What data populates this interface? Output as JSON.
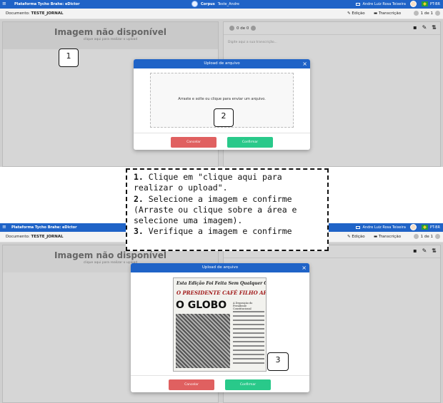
{
  "app": {
    "title": "Plataforma Tycho Brahe: eDictor",
    "corpus_label": "Corpus",
    "corpus_name": "Teste_Andre",
    "user_name": "Andre Luiz Rosa Teixeira",
    "locale": "PT-BR"
  },
  "docbar": {
    "doc_label": "Documento:",
    "doc_name": "TESTE_JORNAL",
    "edit_label": "Edição",
    "transcription_label": "Transcrição",
    "page_indicator": "1 de 1"
  },
  "left_pane": {
    "unavailable": "Imagem não disponível",
    "hint": "clique aqui para realizar o upload"
  },
  "right_pane": {
    "page_count": "0 de 0",
    "placeholder": "Digite aqui a sua transcrição..."
  },
  "modal": {
    "title": "Upload de arquivo",
    "dropzone_text": "Arraste e solte ou clique para enviar um arquivo.",
    "cancel_label": "Cancelar",
    "confirm_label": "Confirmar"
  },
  "newspaper": {
    "line1": "Esta Edição Foi Feita Sem Qualquer Censura",
    "line2": "O PRESIDENTE CAFÉ FILHO APELA PARA O SUPREMO",
    "masthead": "O GLOBO",
    "subhead": "A Deposição do Presidente Constitucional"
  },
  "callouts": [
    "1",
    "2",
    "3"
  ],
  "instructions": {
    "step1_num": "1.",
    "step1": "Clique em \"clique aqui para realizar o upload\".",
    "step2_num": "2.",
    "step2": "Selecione a imagem e confirme (Arraste ou clique sobre a área e selecione uma imagem).",
    "step3_num": "3.",
    "step3": "Verifique a imagem e confirme"
  }
}
